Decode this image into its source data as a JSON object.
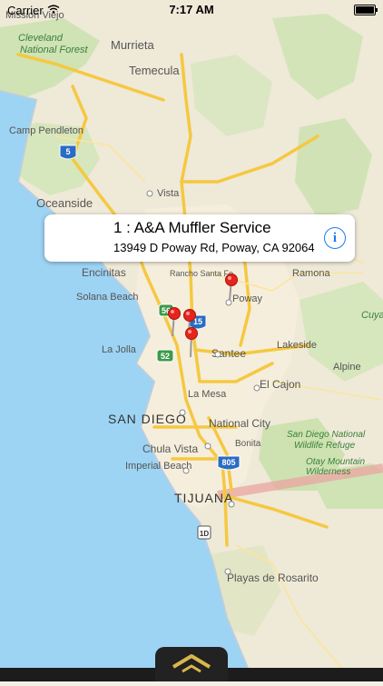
{
  "status_bar": {
    "carrier": "Carrier",
    "time": "7:17 AM"
  },
  "callout": {
    "title": "1 : A&A Muffler Service",
    "subtitle": "13949 D Poway Rd, Poway, CA 92064"
  },
  "map_labels": {
    "mission_viejo": "Mission Viejo",
    "cleveland": "Cleveland",
    "national_forest": "National Forest",
    "murrieta": "Murrieta",
    "temecula": "Temecula",
    "camp_pendleton": "Camp Pendleton",
    "oceanside": "Oceanside",
    "vista": "Vista",
    "encinitas": "Encinitas",
    "rancho_santa_fe": "Rancho Santa Fe",
    "ramona": "Ramona",
    "poway": "Poway",
    "solana_beach": "Solana Beach",
    "cuya": "Cuya",
    "la_jolla": "La Jolla",
    "lakeside": "Lakeside",
    "santee": "Santee",
    "alpine": "Alpine",
    "el_cajon": "El Cajon",
    "la_mesa": "La Mesa",
    "san_diego": "SAN DIEGO",
    "national_city": "National City",
    "san_diego_refuge_1": "San Diego National",
    "san_diego_refuge_2": "Wildlife Refuge",
    "bonita": "Bonita",
    "chula_vista": "Chula Vista",
    "otay_1": "Otay Mountain",
    "otay_2": "Wilderness",
    "imperial_beach": "Imperial Beach",
    "tijuana": "TIJUANA",
    "playas": "Playas de Rosarito"
  },
  "highway_shields": {
    "i5": "5",
    "i15": "15",
    "sr52": "52",
    "sr805": "805",
    "sr56": "56",
    "mx1d": "1D"
  }
}
